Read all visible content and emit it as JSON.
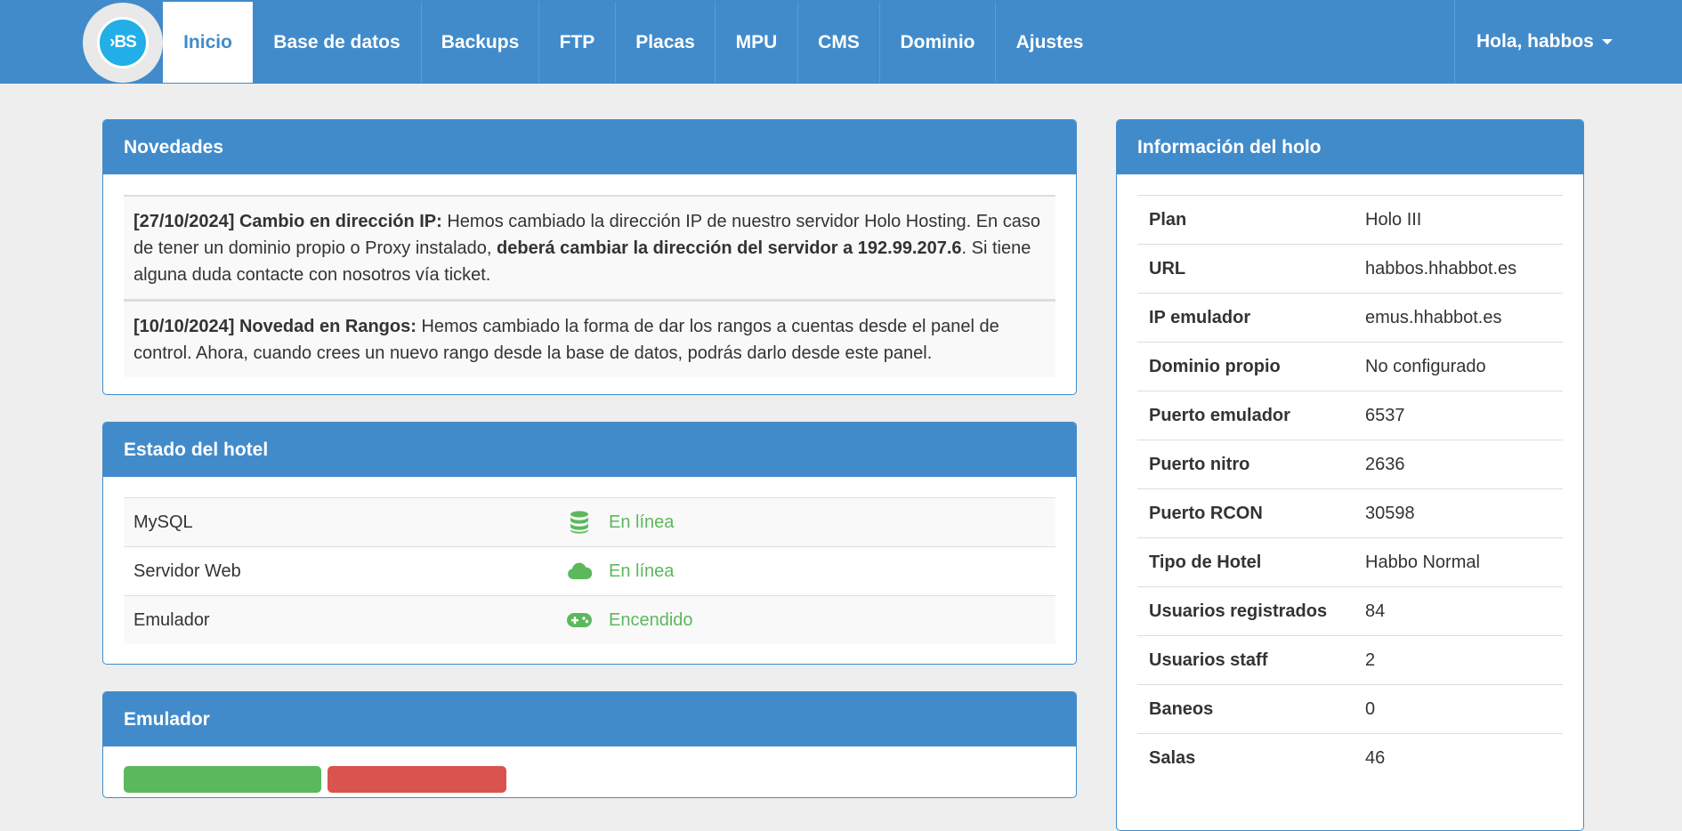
{
  "brand": {
    "logo_text": "›BS"
  },
  "nav": {
    "items": [
      {
        "label": "Inicio",
        "active": true
      },
      {
        "label": "Base de datos"
      },
      {
        "label": "Backups"
      },
      {
        "label": "FTP"
      },
      {
        "label": "Placas"
      },
      {
        "label": "MPU"
      },
      {
        "label": "CMS"
      },
      {
        "label": "Dominio"
      },
      {
        "label": "Ajustes"
      }
    ],
    "user_greeting": "Hola, habbos"
  },
  "news": {
    "title": "Novedades",
    "items": [
      {
        "headline": "[27/10/2024] Cambio en dirección IP:",
        "text1": " Hemos cambiado la dirección IP de nuestro servidor Holo Hosting. En caso de tener un dominio propio o Proxy instalado, ",
        "bold": "deberá cambiar la dirección del servidor a 192.99.207.6",
        "text2": ". Si tiene alguna duda contacte con nosotros vía ticket."
      },
      {
        "headline": "[10/10/2024] Novedad en Rangos:",
        "text1": " Hemos cambiado la forma de dar los rangos a cuentas desde el panel de control. Ahora, cuando crees un nuevo rango desde la base de datos, podrás darlo desde este panel."
      }
    ]
  },
  "status": {
    "title": "Estado del hotel",
    "rows": [
      {
        "name": "MySQL",
        "icon": "database-icon",
        "value": "En línea"
      },
      {
        "name": "Servidor Web",
        "icon": "cloud-icon",
        "value": "En línea"
      },
      {
        "name": "Emulador",
        "icon": "gamepad-icon",
        "value": "Encendido"
      }
    ],
    "online_color": "#5cb85c"
  },
  "emulator": {
    "title": "Emulador"
  },
  "info": {
    "title": "Información del holo",
    "rows": [
      {
        "key": "Plan",
        "value": "Holo III"
      },
      {
        "key": "URL",
        "value": "habbos.hhabbot.es"
      },
      {
        "key": "IP emulador",
        "value": "emus.hhabbot.es"
      },
      {
        "key": "Dominio propio",
        "value": "No configurado"
      },
      {
        "key": "Puerto emulador",
        "value": "6537"
      },
      {
        "key": "Puerto nitro",
        "value": "2636"
      },
      {
        "key": "Puerto RCON",
        "value": "30598"
      },
      {
        "key": "Tipo de Hotel",
        "value": "Habbo Normal"
      },
      {
        "key": "Usuarios registrados",
        "value": "84"
      },
      {
        "key": "Usuarios staff",
        "value": "2"
      },
      {
        "key": "Baneos",
        "value": "0"
      },
      {
        "key": "Salas",
        "value": "46"
      }
    ]
  },
  "colors": {
    "primary": "#428bca",
    "success": "#5cb85c",
    "danger": "#d9534f"
  }
}
